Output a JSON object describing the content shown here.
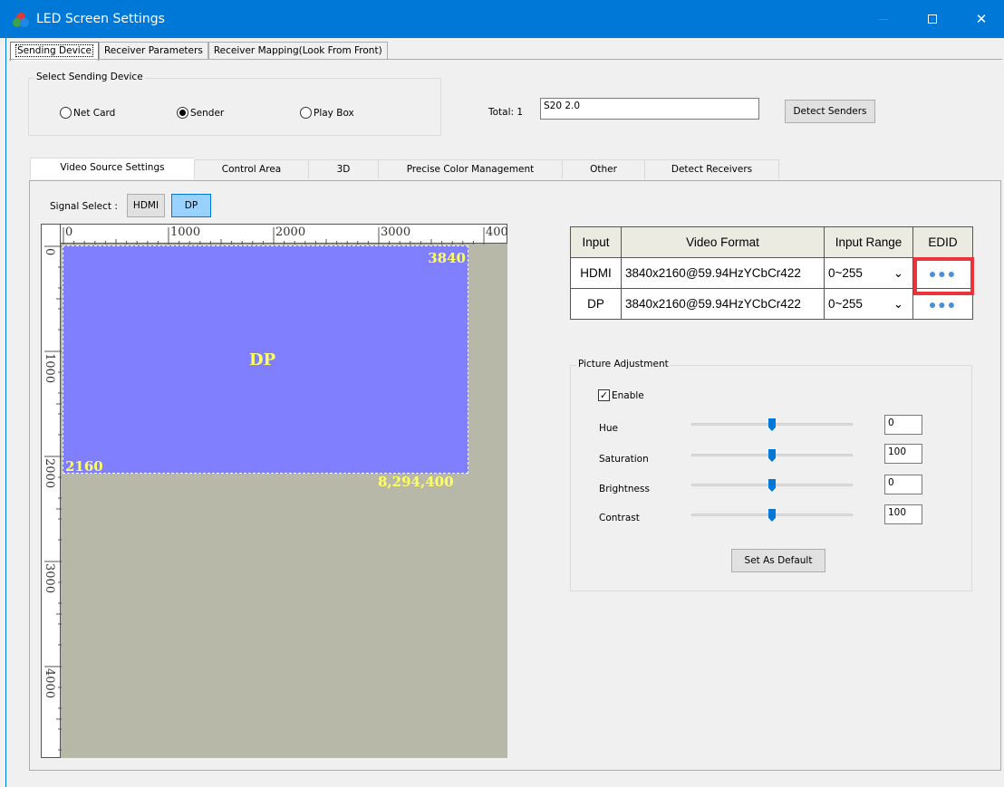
{
  "window": {
    "title": "LED Screen Settings"
  },
  "top_tabs": [
    {
      "label": "Sending Device",
      "active": true
    },
    {
      "label": "Receiver Parameters",
      "active": false
    },
    {
      "label": "Receiver Mapping(Look From Front)",
      "active": false
    }
  ],
  "sending_device": {
    "group_title": "Select Sending Device",
    "options": [
      {
        "label": "Net Card",
        "checked": false
      },
      {
        "label": "Sender",
        "checked": true
      },
      {
        "label": "Play Box",
        "checked": false
      }
    ],
    "total_label": "Total: 1",
    "device_value": "S20 2.0",
    "detect_button": "Detect Senders"
  },
  "sub_tabs": [
    {
      "label": "Video Source Settings",
      "active": true
    },
    {
      "label": "Control Area",
      "active": false
    },
    {
      "label": "3D",
      "active": false
    },
    {
      "label": "Precise Color Management",
      "active": false
    },
    {
      "label": "Other",
      "active": false
    },
    {
      "label": "Detect Receivers",
      "active": false
    }
  ],
  "signal_select": {
    "label": "Signal Select :",
    "buttons": [
      {
        "label": "HDMI",
        "selected": false
      },
      {
        "label": "DP",
        "selected": true
      }
    ]
  },
  "canvas": {
    "ruler_top": [
      "0",
      "1000",
      "2000",
      "3000",
      "400"
    ],
    "ruler_left": [
      "0",
      "1000",
      "2000",
      "3000",
      "4000"
    ],
    "source_name": "DP",
    "width_label": "3840",
    "height_label": "2160",
    "pixels_label": "8,294,400",
    "colors": {
      "source_fill": "#8080ff",
      "background": "#b8b8a9",
      "label_color": "#ffff66"
    }
  },
  "format_table": {
    "headers": [
      "Input",
      "Video Format",
      "Input Range",
      "EDID"
    ],
    "rows": [
      {
        "input": "HDMI",
        "format": "3840x2160@59.94HzYCbCr422",
        "range": "0~255",
        "edid": "●●●"
      },
      {
        "input": "DP",
        "format": "3840x2160@59.94HzYCbCr422",
        "range": "0~255",
        "edid": "●●●"
      }
    ],
    "highlight_color": "#e8343a"
  },
  "picture_adjustment": {
    "group_title": "Picture Adjustment",
    "enable_label": "Enable",
    "enable_checked": true,
    "sliders": [
      {
        "label": "Hue",
        "value": "0",
        "level": 0.5
      },
      {
        "label": "Saturation",
        "value": "100",
        "level": 0.5
      },
      {
        "label": "Brightness",
        "value": "0",
        "level": 0.5
      },
      {
        "label": "Contrast",
        "value": "100",
        "level": 0.5
      }
    ],
    "default_button": "Set As Default"
  }
}
